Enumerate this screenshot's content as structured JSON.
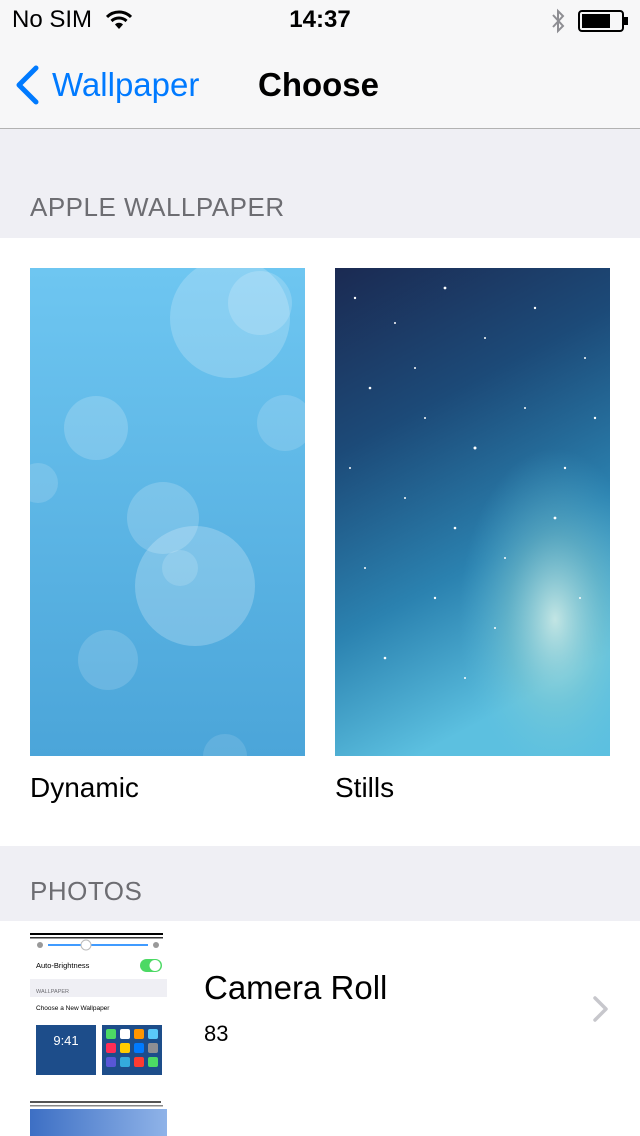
{
  "status_bar": {
    "carrier": "No SIM",
    "time": "14:37",
    "icons": [
      "wifi-icon",
      "bluetooth-icon",
      "battery-icon"
    ]
  },
  "nav": {
    "back_label": "Wallpaper",
    "title": "Choose"
  },
  "sections": {
    "apple_wallpaper": "APPLE WALLPAPER",
    "photos": "PHOTOS"
  },
  "wallpapers": [
    {
      "label": "Dynamic"
    },
    {
      "label": "Stills"
    }
  ],
  "albums": [
    {
      "title": "Camera Roll",
      "count": "83"
    }
  ],
  "thumbnail_text": {
    "auto_brightness": "Auto-Brightness",
    "wallpaper_header": "WALLPAPER",
    "choose_new": "Choose a New Wallpaper",
    "clock": "9:41"
  },
  "colors": {
    "accent": "#007aff",
    "background": "#efeff4",
    "section_text": "#6d6d72"
  }
}
